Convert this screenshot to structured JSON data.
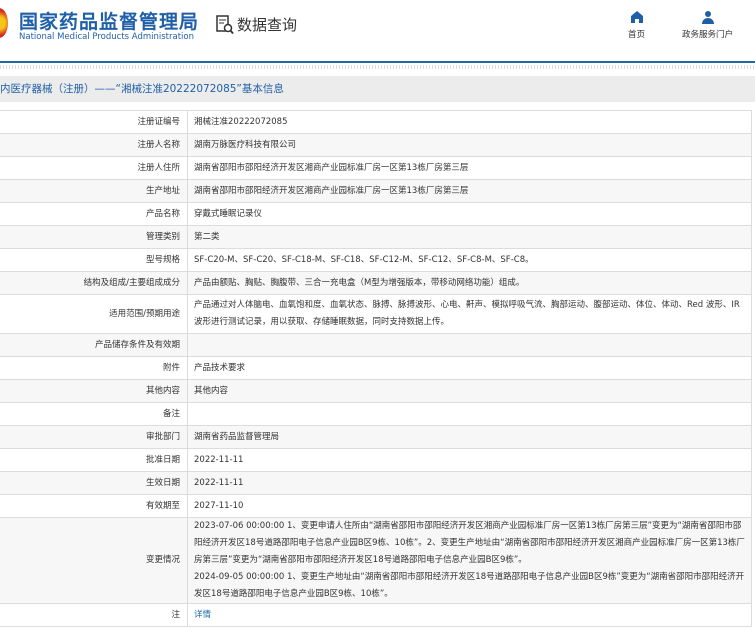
{
  "header": {
    "logo_cn": "国家药品监督管理局",
    "logo_en": "National Medical Products Administration",
    "section": "数据查询",
    "nav": [
      {
        "label": "首页",
        "icon": "home-icon"
      },
      {
        "label": "政务服务门户",
        "icon": "user-icon"
      }
    ]
  },
  "breadcrumb": "内医疗器械（注册）——“湘械注准20222072085”基本信息",
  "rows": [
    {
      "label": "注册证编号",
      "value": "湘械注准20222072085"
    },
    {
      "label": "注册人名称",
      "value": "湖南万脉医疗科技有限公司"
    },
    {
      "label": "注册人住所",
      "value": "湖南省邵阳市邵阳经济开发区湘商产业园标准厂房一区第13栋厂房第三层"
    },
    {
      "label": "生产地址",
      "value": "湖南省邵阳市邵阳经济开发区湘商产业园标准厂房一区第13栋厂房第三层"
    },
    {
      "label": "产品名称",
      "value": "穿戴式睡眠记录仪"
    },
    {
      "label": "管理类别",
      "value": "第二类"
    },
    {
      "label": "型号规格",
      "value": "SF-C20-M、SF-C20、SF-C18-M、SF-C18、SF-C12-M、SF-C12、SF-C8-M、SF-C8。"
    },
    {
      "label": "结构及组成/主要组成成分",
      "value": "产品由额贴、胸贴、胸腹带、三合一充电盒（M型为增强版本，带移动网络功能）组成。"
    },
    {
      "label": "适用范围/预期用途",
      "value": "产品通过对人体脑电、血氧饱和度、血氧状态、脉搏、脉搏波形、心电、鼾声、模拟呼吸气流、胸部运动、腹部运动、体位、体动、Red 波形、IR 波形进行测试记录，用以获取、存储睡眠数据，同时支持数据上传。"
    },
    {
      "label": "产品储存条件及有效期",
      "value": ""
    },
    {
      "label": "附件",
      "value": "产品技术要求"
    },
    {
      "label": "其他内容",
      "value": "其他内容"
    },
    {
      "label": "备注",
      "value": ""
    },
    {
      "label": "审批部门",
      "value": "湖南省药品监督管理局"
    },
    {
      "label": "批准日期",
      "value": "2022-11-11"
    },
    {
      "label": "生效日期",
      "value": "2022-11-11"
    },
    {
      "label": "有效期至",
      "value": "2027-11-10"
    },
    {
      "label": "变更情况",
      "value": "2023-07-06 00:00:00 1、变更申请人住所由“湖南省邵阳市邵阳经济开发区湘商产业园标准厂房一区第13栋厂房第三层”变更为“湖南省邵阳市邵阳经济开发区18号道路邵阳电子信息产业园B区9栋、10栋”。2、变更生产地址由“湖南省邵阳市邵阳经济开发区湘商产业园标准厂房一区第13栋厂房第三层”变更为“湖南省邵阳市邵阳经济开发区18号道路邵阳电子信息产业园B区9栋”。\n2024-09-05 00:00:00 1、变更生产地址由“湖南省邵阳市邵阳经济开发区18号道路邵阳电子信息产业园B区9栋”变更为“湖南省邵阳市邵阳经济开发区18号道路邵阳电子信息产业园B区9栋、10栋”。"
    },
    {
      "label": "注",
      "value": "详情"
    }
  ]
}
